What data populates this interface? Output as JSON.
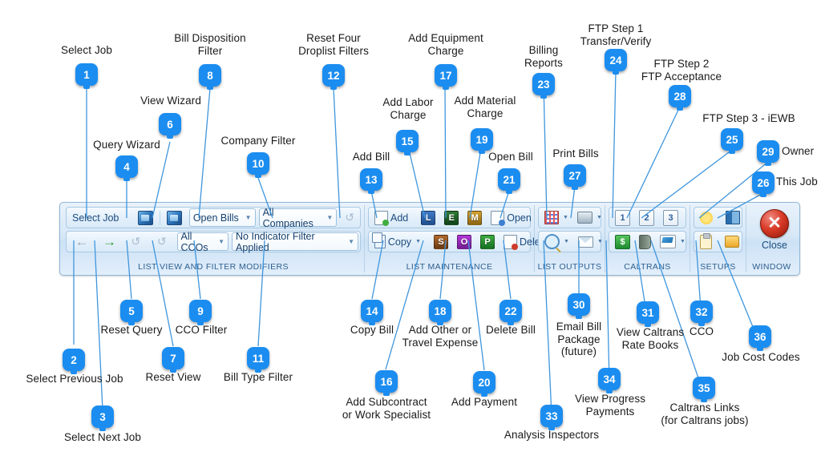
{
  "ribbon": {
    "groups": [
      {
        "id": "list-view-filter",
        "title": "LIST VIEW AND FILTER MODIFIERS",
        "row1": {
          "select_job_label": "Select Job",
          "job_picker_icon": "job-image-icon",
          "query_wizard_icon": "query-wizard-icon",
          "bill_disposition_value": "Open Bills",
          "company_filter_value": "All Companies",
          "reset_filters_icon": "reset-filters-icon"
        },
        "row2": {
          "prev_job_icon": "arrow-left-icon",
          "next_job_icon": "arrow-right-icon",
          "reset_query_icon": "reset-query-icon",
          "reset_view_icon": "reset-view-icon",
          "cco_filter_value": "All CCOs",
          "bill_type_filter_value": "No Indicator Filter Applied"
        }
      },
      {
        "id": "list-maintenance",
        "title": "LIST MAINTENANCE",
        "row1": {
          "add_label": "Add",
          "labor_letter": "L",
          "equipment_letter": "E",
          "material_letter": "M",
          "open_label": "Open"
        },
        "row2": {
          "copy_label": "Copy",
          "subcontract_letter": "S",
          "other_letter": "O",
          "payment_letter": "P",
          "delete_label": "Delete"
        }
      },
      {
        "id": "list-outputs",
        "title": "LIST OUTPUTS",
        "row1": {
          "billing_reports_icon": "billing-reports-icon",
          "print_bills_icon": "printer-icon"
        },
        "row2": {
          "analysis_icon": "magnifier-icon",
          "email_icon": "envelope-icon"
        }
      },
      {
        "id": "caltrans",
        "title": "CALTRANS",
        "row1": {
          "step1": "1",
          "step2": "2",
          "step3": "3"
        },
        "row2": {
          "progress_payments_icon": "dollar-icon",
          "rate_books_icon": "book-icon",
          "caltrans_links_icon": "caltrans-links-icon"
        }
      },
      {
        "id": "setups",
        "title": "SETUPS",
        "row1": {
          "owner_icon": "sun-icon",
          "this_job_icon": "books-icon"
        },
        "row2": {
          "cco_icon": "clipboard-icon",
          "job_cost_codes_icon": "folder-icon"
        }
      },
      {
        "id": "window",
        "title": "WINDOW",
        "close_label": "Close",
        "close_icon": "close-x-icon"
      }
    ]
  },
  "callouts": [
    {
      "n": "1",
      "text": "Select Job"
    },
    {
      "n": "2",
      "text": "Select Previous Job"
    },
    {
      "n": "3",
      "text": "Select Next Job"
    },
    {
      "n": "4",
      "text": "Query Wizard"
    },
    {
      "n": "5",
      "text": "Reset Query"
    },
    {
      "n": "6",
      "text": "View Wizard"
    },
    {
      "n": "7",
      "text": "Reset View"
    },
    {
      "n": "8",
      "text": "Bill Disposition\nFilter"
    },
    {
      "n": "9",
      "text": "CCO Filter"
    },
    {
      "n": "10",
      "text": "Company Filter"
    },
    {
      "n": "11",
      "text": "Bill Type Filter"
    },
    {
      "n": "12",
      "text": "Reset Four\nDroplist Filters"
    },
    {
      "n": "13",
      "text": "Add Bill"
    },
    {
      "n": "14",
      "text": "Copy Bill"
    },
    {
      "n": "15",
      "text": "Add Labor\nCharge"
    },
    {
      "n": "16",
      "text": "Add Subcontract\nor Work Specialist"
    },
    {
      "n": "17",
      "text": "Add Equipment\nCharge"
    },
    {
      "n": "18",
      "text": "Add Other or\nTravel Expense"
    },
    {
      "n": "19",
      "text": "Add Material\nCharge"
    },
    {
      "n": "20",
      "text": "Add Payment"
    },
    {
      "n": "21",
      "text": "Open Bill"
    },
    {
      "n": "22",
      "text": "Delete Bill"
    },
    {
      "n": "23",
      "text": "Billing\nReports"
    },
    {
      "n": "24",
      "text": "FTP Step 1\nTransfer/Verify"
    },
    {
      "n": "25",
      "text": "FTP Step 3 - iEWB"
    },
    {
      "n": "26",
      "text": "This Job"
    },
    {
      "n": "27",
      "text": "Print Bills"
    },
    {
      "n": "28",
      "text": "FTP Step 2\nFTP Acceptance"
    },
    {
      "n": "29",
      "text": "Owner"
    },
    {
      "n": "30",
      "text": "Email Bill\nPackage\n(future)"
    },
    {
      "n": "31",
      "text": "View Caltrans\nRate Books"
    },
    {
      "n": "32",
      "text": "CCO"
    },
    {
      "n": "33",
      "text": "Analysis Inspectors"
    },
    {
      "n": "34",
      "text": "View Progress\nPayments"
    },
    {
      "n": "35",
      "text": "Caltrans Links\n(for Caltrans jobs)"
    },
    {
      "n": "36",
      "text": "Job Cost Codes"
    }
  ],
  "colors": {
    "badge": "#1b8df0",
    "leader": "#3f96dd",
    "labor": "#2a5fa8",
    "equipment": "#1d5a24",
    "material": "#a8791a",
    "subcontract": "#8a4a1c",
    "other": "#8a22a8",
    "payment": "#1f8a2e"
  }
}
